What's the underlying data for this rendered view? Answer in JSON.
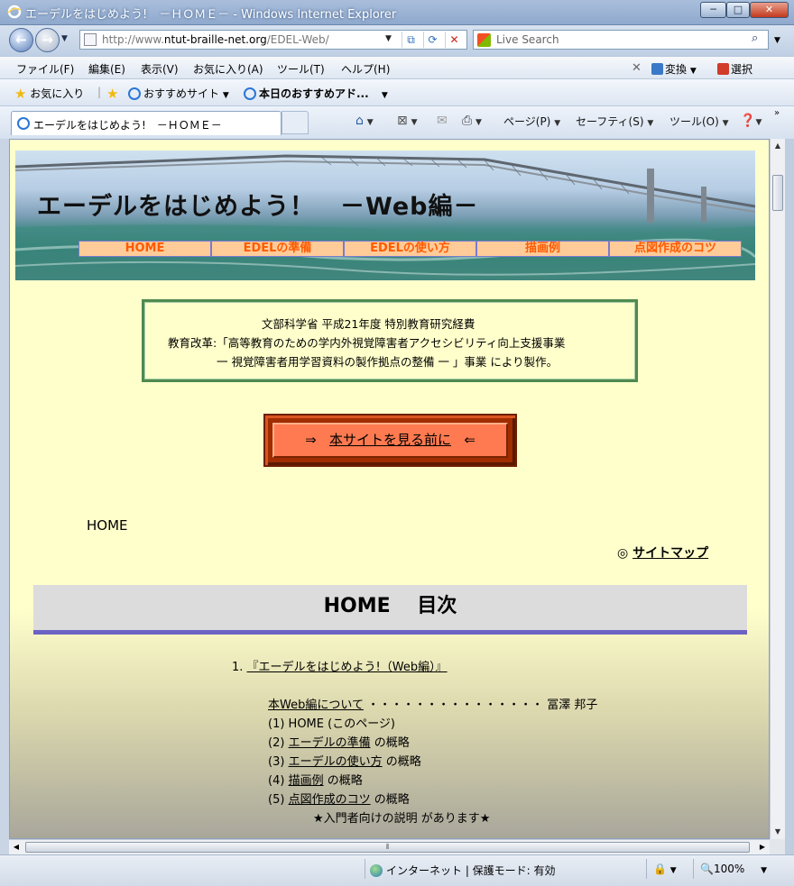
{
  "window": {
    "title": "エーデルをはじめよう!　－ＨＯＭＥ－ - Windows Internet Explorer",
    "min_label": "─",
    "max_label": "□",
    "close_label": "✕"
  },
  "address": {
    "url_prefix": "http://www.",
    "url_domain": "ntut-braille-net.org",
    "url_suffix": "/EDEL-Web/",
    "search_placeholder": "Live Search"
  },
  "menu": [
    "ファイル(F)",
    "編集(E)",
    "表示(V)",
    "お気に入り(A)",
    "ツール(T)",
    "ヘルプ(H)"
  ],
  "menu_right": {
    "convert": "変換",
    "select": "選択"
  },
  "favorites": {
    "favorites_label": "お気に入り",
    "suggested_sites": "おすすめサイト",
    "todays_pick": "本日のおすすめアド..."
  },
  "tab": {
    "title": "エーデルをはじめよう!　－ＨＯＭＥ－"
  },
  "commands": {
    "page": "ページ(P)",
    "safety": "セーフティ(S)",
    "tools": "ツール(O)"
  },
  "site": {
    "title": "エーデルをはじめよう！　－Web編－",
    "nav": [
      "HOME",
      "EDELの準備",
      "EDELの使い方",
      "描画例",
      "点図作成のコツ"
    ]
  },
  "funding": {
    "line1": "文部科学省 平成21年度 特別教育研究経費",
    "line2": "教育改革:「高等教育のための学内外視覚障害者アクセシビリティ向上支援事業",
    "line3": "一 視覚障害者用学習資料の製作拠点の整備 一 」事業 により製作。"
  },
  "pre_button": {
    "left": "⇒",
    "label": "本サイトを見る前に",
    "right": "⇐"
  },
  "breadcrumb": "HOME",
  "sitemap": {
    "mark": "◎",
    "label": "サイトマップ"
  },
  "toc_heading": "HOME　 目次",
  "toc": {
    "item1_num": "1.",
    "item1_link": "『エーデルをはじめよう!（Web編）』",
    "about_link": "本Web編について",
    "about_dots": "・・・・・・・・・・・・・・・",
    "about_author": "冨澤 邦子",
    "line1": "(1) HOME (このページ)",
    "line2_num": "(2)",
    "line2_link": "エーデルの準備",
    "line2_tail": "の概略",
    "line3_num": "(3)",
    "line3_link": "エーデルの使い方",
    "line3_tail": "の概略",
    "line4_num": "(4)",
    "line4_link": "描画例",
    "line4_tail": "の概略",
    "line5_num": "(5)",
    "line5_link": "点図作成のコツ",
    "line5_tail": "の概略",
    "note": "★入門者向けの説明 があります★"
  },
  "status": {
    "zone": "インターネット | 保護モード: 有効",
    "zoom": "100%"
  }
}
